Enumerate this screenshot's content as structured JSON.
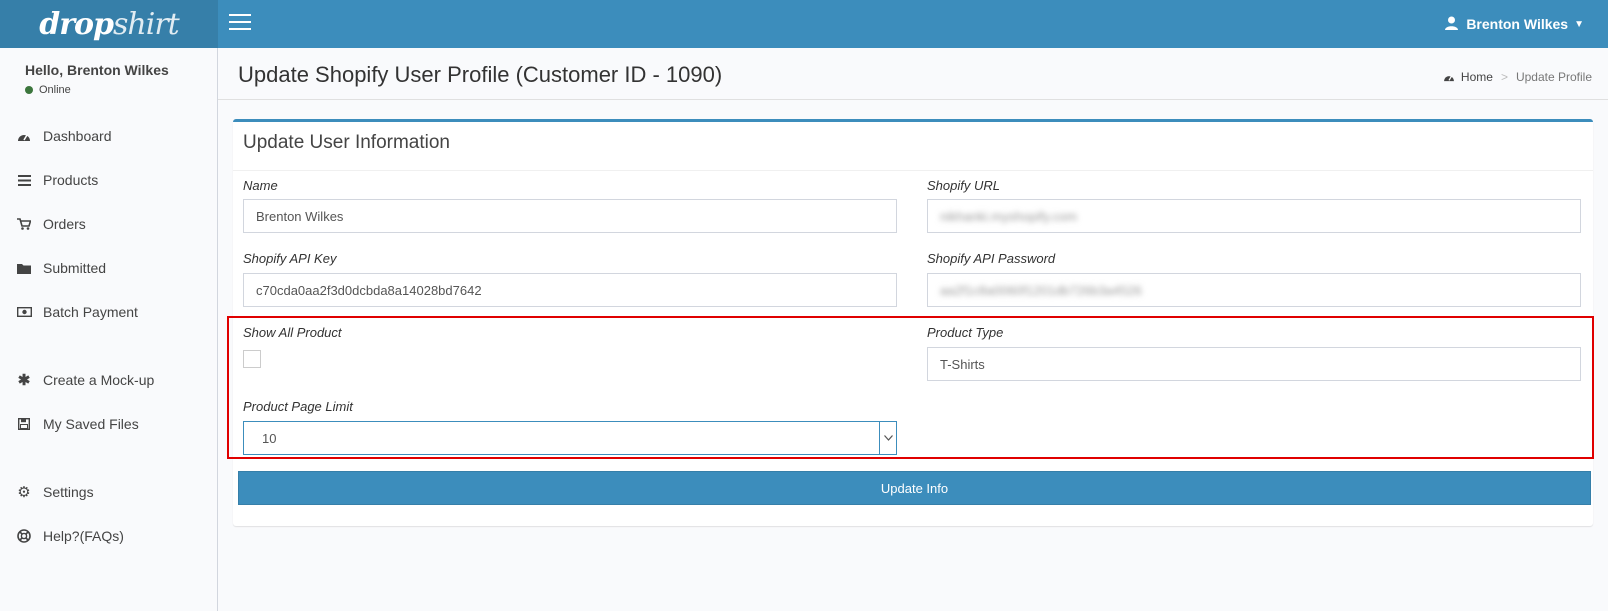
{
  "app": {
    "logo_text_a": "drop",
    "logo_text_b": "shirt"
  },
  "topbar": {
    "user_name": "Brenton Wilkes"
  },
  "sidebar": {
    "greeting": "Hello, Brenton Wilkes",
    "status": "Online",
    "items": [
      {
        "label": "Dashboard",
        "icon": "dashboard-icon"
      },
      {
        "label": "Products",
        "icon": "list-icon"
      },
      {
        "label": "Orders",
        "icon": "cart-icon"
      },
      {
        "label": "Submitted",
        "icon": "folder-icon"
      },
      {
        "label": "Batch Payment",
        "icon": "money-icon"
      },
      {
        "label": "Create a Mock-up",
        "icon": "asterisk-icon"
      },
      {
        "label": "My Saved Files",
        "icon": "save-icon"
      },
      {
        "label": "Settings",
        "icon": "gear-icon"
      },
      {
        "label": "Help?(FAQs)",
        "icon": "lifebuoy-icon"
      }
    ]
  },
  "header": {
    "title": "Update Shopify User Profile (Customer ID - 1090)",
    "breadcrumb": {
      "home": "Home",
      "current": "Update Profile"
    }
  },
  "form": {
    "box_title": "Update User Information",
    "name": {
      "label": "Name",
      "value": "Brenton Wilkes"
    },
    "shopify_url": {
      "label": "Shopify URL",
      "value": "nikhanki.myshopify.com"
    },
    "api_key": {
      "label": "Shopify API Key",
      "value": "c70cda0aa2f3d0dcbda8a14028bd7642"
    },
    "api_password": {
      "label": "Shopify API Password",
      "value": "aa2f1c8a0060f1201db726b3a4526"
    },
    "show_all_product": {
      "label": "Show All Product",
      "checked": false
    },
    "product_type": {
      "label": "Product Type",
      "value": "T-Shirts"
    },
    "page_limit": {
      "label": "Product Page Limit",
      "value": "10"
    },
    "submit_label": "Update Info"
  },
  "colors": {
    "primary": "#3c8dbc",
    "primary_dark": "#367fa9",
    "highlight": "#e00000"
  }
}
